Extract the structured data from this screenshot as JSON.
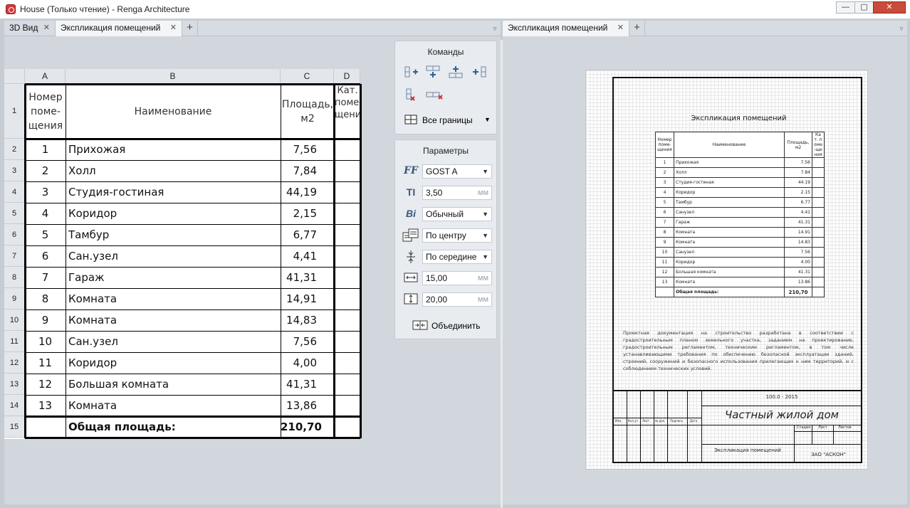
{
  "window": {
    "title": "House (Только чтение) - Renga Architecture",
    "min": "—",
    "max": "▢",
    "close": "✕"
  },
  "left_tabs": [
    {
      "label": "3D Вид",
      "close": "✕"
    },
    {
      "label": "Экспликация помещений",
      "close": "✕"
    }
  ],
  "right_tabs": [
    {
      "label": "Экспликация помещений",
      "close": "✕"
    }
  ],
  "tab_add": "+",
  "tab_menu": "▿",
  "sheet": {
    "columns": [
      "A",
      "B",
      "C",
      "D"
    ],
    "header": {
      "a": "Номер поме-щения",
      "b": "Наименование",
      "c": "Площадь, м2",
      "d": "Кат. поме-щения"
    },
    "rows": [
      {
        "n": "1",
        "name": "Прихожая",
        "area": "7,56"
      },
      {
        "n": "2",
        "name": "Холл",
        "area": "7,84"
      },
      {
        "n": "3",
        "name": "Студия-гостиная",
        "area": "44,19"
      },
      {
        "n": "4",
        "name": "Коридор",
        "area": "2,15"
      },
      {
        "n": "5",
        "name": "Тамбур",
        "area": "6,77"
      },
      {
        "n": "6",
        "name": "Сан.узел",
        "area": "4,41"
      },
      {
        "n": "7",
        "name": "Гараж",
        "area": "41,31"
      },
      {
        "n": "8",
        "name": "Комната",
        "area": "14,91"
      },
      {
        "n": "9",
        "name": "Комната",
        "area": "14,83"
      },
      {
        "n": "10",
        "name": "Сан.узел",
        "area": "7,56"
      },
      {
        "n": "11",
        "name": "Коридор",
        "area": "4,00"
      },
      {
        "n": "12",
        "name": "Большая комната",
        "area": "41,31"
      },
      {
        "n": "13",
        "name": "Комната",
        "area": "13,86"
      }
    ],
    "total_label": "Общая площадь:",
    "total_value": "210,70",
    "row_numbers": [
      "1",
      "2",
      "3",
      "4",
      "5",
      "6",
      "7",
      "8",
      "9",
      "10",
      "11",
      "12",
      "13",
      "14",
      "15"
    ]
  },
  "commands_panel": {
    "title": "Команды",
    "tools": [
      "insert-column-left-icon",
      "insert-row-above-icon",
      "insert-row-below-icon",
      "insert-column-right-icon",
      "delete-column-icon",
      "delete-row-icon"
    ],
    "borders_label": "Все границы",
    "dropdown_arrow": "▼"
  },
  "params_panel": {
    "title": "Параметры",
    "font_icon": "FF",
    "font": "GOST A",
    "size_icon": "TI",
    "size": "3,50",
    "style_icon": "Bi",
    "style": "Обычный",
    "halign": "По центру",
    "valign": "По середине",
    "width": "15,00",
    "height": "20,00",
    "unit": "мм",
    "merge_label": "Объединить"
  },
  "drawing": {
    "title": "Экспликация помещений",
    "header": [
      "Номер поме-щения",
      "Наименование",
      "Площадь, м2",
      "Кат. поме-щения"
    ],
    "rows": [
      [
        "1",
        "Прихожая",
        "7.56"
      ],
      [
        "2",
        "Холл",
        "7.84"
      ],
      [
        "3",
        "Студия-гостиная",
        "44.19"
      ],
      [
        "4",
        "Коридор",
        "2.15"
      ],
      [
        "5",
        "Тамбур",
        "6.77"
      ],
      [
        "6",
        "Санузел",
        "4.41"
      ],
      [
        "7",
        "Гараж",
        "41.31"
      ],
      [
        "8",
        "Комната",
        "14.91"
      ],
      [
        "9",
        "Комната",
        "14.83"
      ],
      [
        "10",
        "Санузел",
        "7.56"
      ],
      [
        "11",
        "Коридор",
        "4.00"
      ],
      [
        "12",
        "Большая комната",
        "41.31"
      ],
      [
        "13",
        "Комната",
        "13.86"
      ]
    ],
    "total_label": "Общая площадь:",
    "total_value": "210,70",
    "note": "Проектная документация на строительство разработана в соответствии с градостроительным планом земельного участка, заданием на проектирование, градостроительным регламентом, техническим регламентом, в том числе устанавливающими требования по обеспечению безопасной эксплуатации зданий, строений, сооружений и безопасного использования прилегающих к ним территорий, и с соблюдением технических условий.",
    "stamp_code": "100.0 - 2015",
    "stamp_project": "Частный жилой дом",
    "stamp_cols": [
      "Изм.",
      "Кол.уч",
      "Лист",
      "№ док.",
      "Подпись",
      "Дата"
    ],
    "stamp_stage_cols": [
      "Стадия",
      "Лист",
      "Листов"
    ],
    "stamp_sheet": "Экспликация помещений",
    "stamp_org": "ЗАО \"АСКОН\""
  }
}
